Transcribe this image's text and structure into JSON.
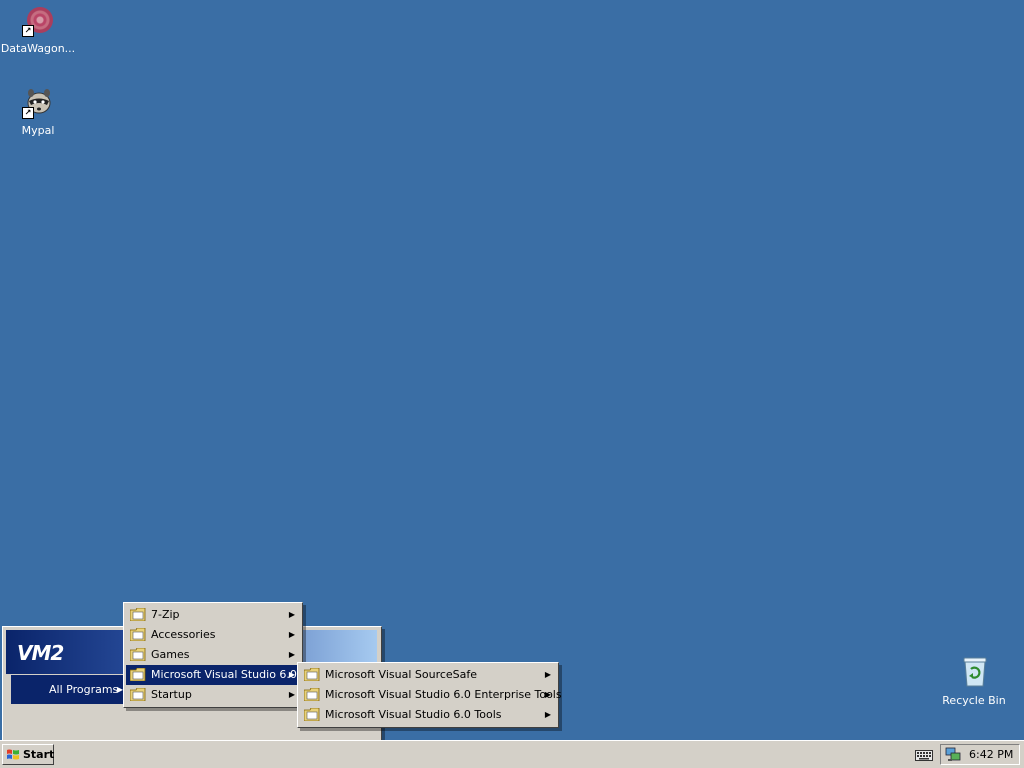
{
  "desktop": {
    "icons": [
      {
        "label": "DataWagon..."
      },
      {
        "label": "Mypal"
      },
      {
        "label": "Recycle Bin"
      }
    ]
  },
  "start_menu": {
    "banner_text": "VM2",
    "all_programs_label": "All Programs"
  },
  "programs_menu": {
    "items": [
      {
        "label": "7-Zip"
      },
      {
        "label": "Accessories"
      },
      {
        "label": "Games"
      },
      {
        "label": "Microsoft Visual Studio 6.0"
      },
      {
        "label": "Startup"
      }
    ]
  },
  "vs_menu": {
    "items": [
      {
        "label": "Microsoft Visual SourceSafe"
      },
      {
        "label": "Microsoft Visual Studio 6.0 Enterprise Tools"
      },
      {
        "label": "Microsoft Visual Studio 6.0 Tools"
      }
    ]
  },
  "taskbar": {
    "start_label": "Start",
    "clock": "6:42 PM"
  },
  "colors": {
    "desktop": "#3a6ea5",
    "highlight": "#0a246a",
    "face": "#d4d0c8"
  }
}
